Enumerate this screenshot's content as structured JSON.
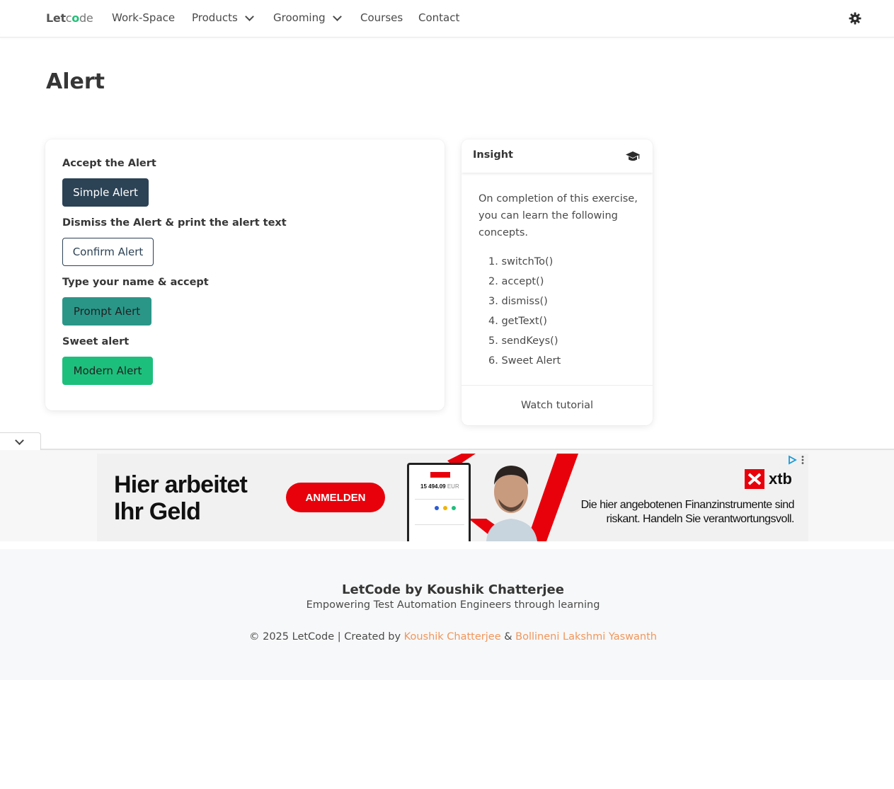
{
  "nav": {
    "logo_let": "Let",
    "logo_c": "c",
    "logo_o": "o",
    "logo_de": "de",
    "items": [
      {
        "label": "Work-Space"
      },
      {
        "label": "Products"
      },
      {
        "label": "Grooming"
      },
      {
        "label": "Courses"
      },
      {
        "label": "Contact"
      }
    ],
    "theme_icon": "gear-icon"
  },
  "page": {
    "title": "Alert"
  },
  "alerts": {
    "sections": [
      {
        "label": "Accept the Alert",
        "button": "Simple Alert"
      },
      {
        "label": "Dismiss the Alert & print the alert text",
        "button": "Confirm Alert"
      },
      {
        "label": "Type your name & accept",
        "button": "Prompt Alert"
      },
      {
        "label": "Sweet alert",
        "button": "Modern Alert"
      }
    ],
    "colors": {
      "dark": "#2c4255",
      "teal": "#2a9688",
      "green": "#1dbf7c"
    }
  },
  "insight": {
    "title": "Insight",
    "icon": "graduation-cap-icon",
    "text": "On completion of this exercise, you can learn the following concepts.",
    "concepts": [
      "1. switchTo()",
      "2. accept()",
      "3. dismiss()",
      "4. getText()",
      "5. sendKeys()",
      "6. Sweet Alert"
    ],
    "footer_link": "Watch tutorial"
  },
  "ad": {
    "headline_line1": "Hier arbeitet",
    "headline_line2": "Ihr Geld",
    "cta": "ANMELDEN",
    "phone_value": "15 494.09",
    "phone_currency": "EUR",
    "brand": "xtb",
    "disclaimer_line1": "Die hier angebotenen Finanzinstrumente sind",
    "disclaimer_line2": "riskant. Handeln Sie verantwortungsvoll.",
    "brand_color": "#e8000b"
  },
  "footer": {
    "title": "LetCode by Koushik Chatterjee",
    "tagline": "Empowering Test Automation Engineers through learning",
    "copy_prefix": "© 2025 LetCode | Created by",
    "author1": "Koushik Chatterjee",
    "amp": "&",
    "author2": "Bollineni Lakshmi Yaswanth",
    "link_color": "#f0965b"
  }
}
